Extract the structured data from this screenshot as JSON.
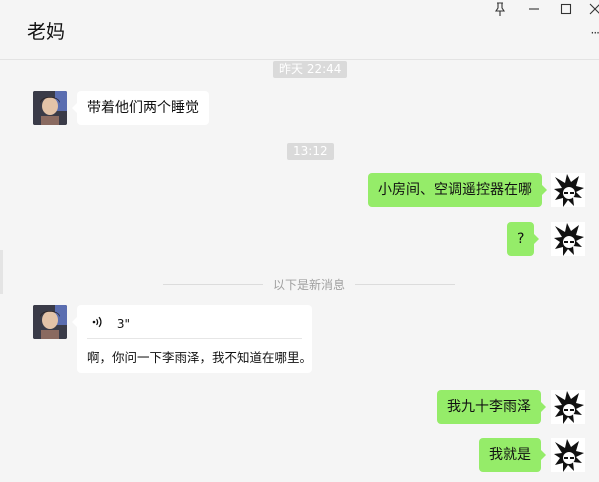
{
  "window": {
    "title": "老妈",
    "pin_icon": "pin-icon",
    "minimize_icon": "minimize-icon",
    "maximize_icon": "maximize-icon",
    "close_icon": "close-icon",
    "more_icon": "more-dots-icon"
  },
  "timestamps": [
    "昨天 22:44",
    "13:12"
  ],
  "messages": [
    {
      "side": "left",
      "text": "带着他们两个睡觉"
    },
    {
      "side": "right",
      "text": "小房间、空调遥控器在哪"
    },
    {
      "side": "right",
      "text": "?"
    }
  ],
  "divider": "以下是新消息",
  "voice": {
    "duration": "3\"",
    "transcript": "啊，你问一下李雨泽，我不知道在哪里。"
  },
  "messages_after": [
    {
      "side": "right",
      "text": "我九十李雨泽"
    },
    {
      "side": "right",
      "text": "我就是"
    }
  ],
  "colors": {
    "bubble_mine": "#95ec69",
    "bubble_other": "#ffffff",
    "background": "#f5f5f5"
  }
}
